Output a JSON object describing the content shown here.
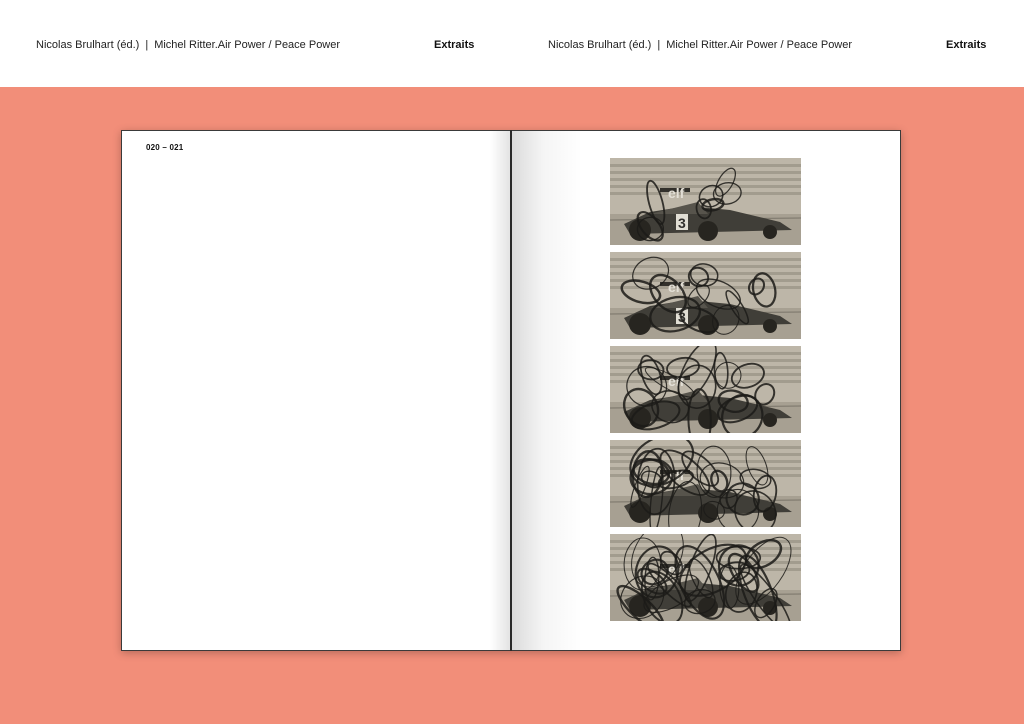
{
  "header": {
    "left_credit": {
      "authors": "Nicolas Brulhart (éd.)",
      "separator": "|",
      "title": "Michel Ritter.Air Power / Peace Power"
    },
    "left_section": "Extraits",
    "right_credit": {
      "authors": "Nicolas Brulhart (éd.)",
      "separator": "|",
      "title": "Michel Ritter.Air Power / Peace Power"
    },
    "right_section": "Extraits"
  },
  "spread": {
    "page_numbers": "020 – 021",
    "photos": [
      {
        "logo": "elf",
        "number": "3",
        "scribble_density": 1
      },
      {
        "logo": "elf",
        "number": "3",
        "scribble_density": 2
      },
      {
        "logo": "elf",
        "number": "",
        "scribble_density": 3
      },
      {
        "logo": "elf",
        "number": "",
        "scribble_density": 4
      },
      {
        "logo": "elf",
        "number": "",
        "scribble_density": 5
      }
    ]
  },
  "colors": {
    "background": "#f28e79",
    "page": "#ffffff",
    "header_bg": "#ffffff"
  }
}
